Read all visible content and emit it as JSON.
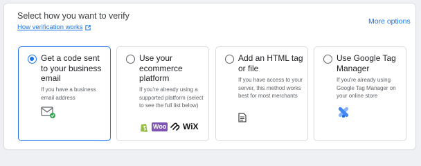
{
  "header": {
    "title": "Select how you want to verify",
    "help_link": "How verification works",
    "more_options": "More options"
  },
  "options": [
    {
      "title": "Get a code sent to your business email",
      "description": "If you have a business email address",
      "selected": true,
      "icon": "envelope-check-icon"
    },
    {
      "title": "Use your ecommerce platform",
      "description": "If you're already using a supported platform (select to see the full list below)",
      "selected": false,
      "logos": [
        "shopify-logo",
        "woocommerce-logo",
        "squarespace-logo",
        "wix-logo"
      ],
      "wix_text": "WiX",
      "woo_text": "Woo"
    },
    {
      "title": "Add an HTML tag or file",
      "description": "If you have access to your server, this method works best for most merchants",
      "selected": false,
      "icon": "file-icon"
    },
    {
      "title": "Use Google Tag Manager",
      "description": "If you're already using Google Tag Manager on your online store",
      "selected": false,
      "icon": "tag-manager-icon"
    }
  ],
  "colors": {
    "accent": "#1a73e8",
    "shopify": "#95bf47",
    "woo": "#7f54b3",
    "tagmanager": "#4285f4"
  }
}
